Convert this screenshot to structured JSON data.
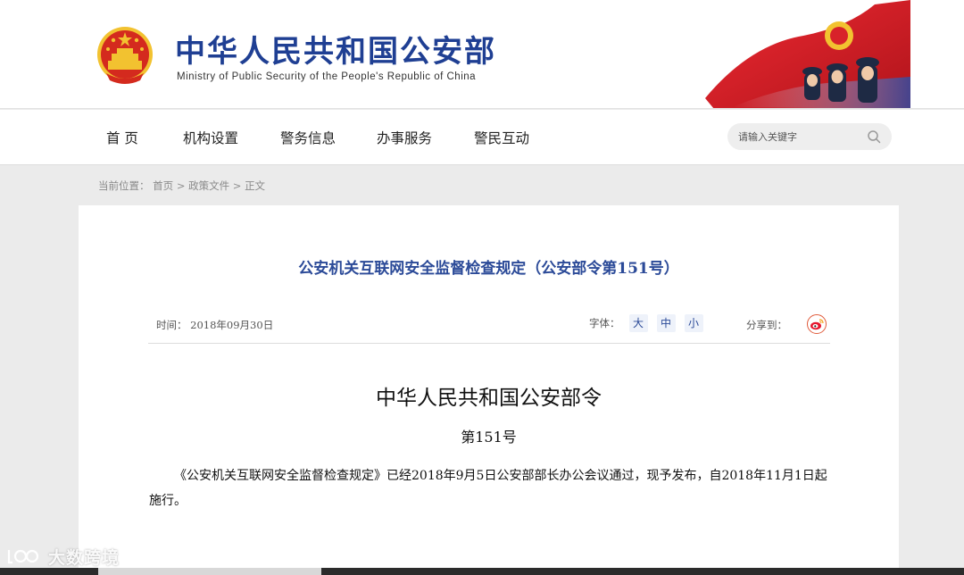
{
  "header": {
    "site_title": "中华人民共和国公安部",
    "site_subtitle": "Ministry of Public Security of the People's Republic of China",
    "emblem_icon": "national-emblem-icon",
    "banner_image": "police-flag-banner",
    "colors": {
      "brand": "#1f3f93",
      "flag_red": "#c8161d"
    }
  },
  "nav": {
    "items": [
      {
        "label": "首 页"
      },
      {
        "label": "机构设置"
      },
      {
        "label": "警务信息"
      },
      {
        "label": "办事服务"
      },
      {
        "label": "警民互动"
      }
    ],
    "search": {
      "placeholder": "请输入关键字",
      "icon": "search-icon"
    }
  },
  "breadcrumb": {
    "prefix": "当前位置：",
    "items": [
      "首页",
      "政策文件",
      "正文"
    ],
    "separator": ">"
  },
  "article": {
    "title": "公安机关互联网安全监督检查规定（公安部令第151号）",
    "date_label": "时间：",
    "date": "2018年09月30日",
    "font_label": "字体：",
    "font_sizes": [
      "大",
      "中",
      "小"
    ],
    "share_label": "分享到：",
    "share_icon": "weibo-icon",
    "heading": "中华人民共和国公安部令",
    "number": "第151号",
    "body": "《公安机关互联网安全监督检查规定》已经2018年9月5日公安部部长办公会议通过，现予发布，自2018年11月1日起施行。"
  },
  "watermark": {
    "text": "大数跨境"
  }
}
